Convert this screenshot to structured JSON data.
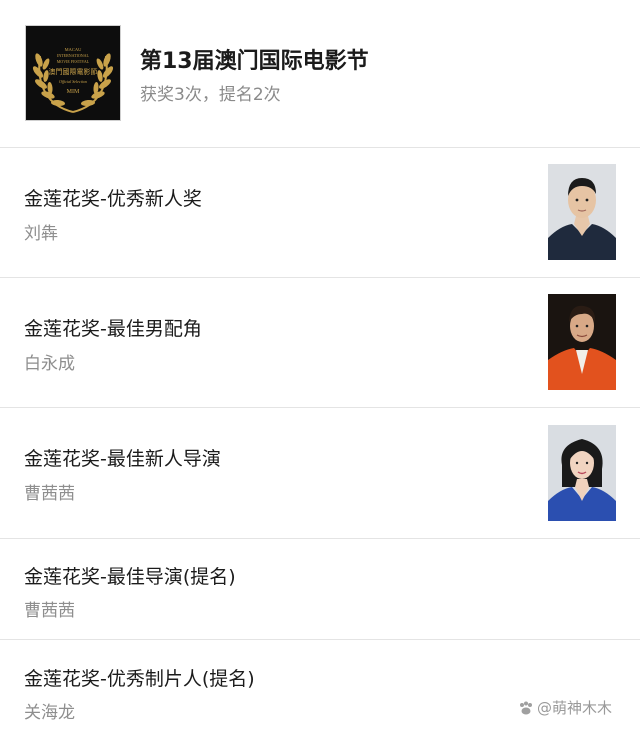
{
  "festival": {
    "title": "第13届澳门国际电影节",
    "stats": "获奖3次，提名2次",
    "logo": {
      "icon": "laurel-wreath-logo",
      "line1": "MACAU",
      "line2": "INTERNATIONAL",
      "line3": "MOVIE FESTIVAL",
      "name_cn": "澳門國際電影節",
      "selection": "Official Selection",
      "abbr": "MIM",
      "colors": {
        "background": "#0d0d0d",
        "gold": "#c9a24a"
      }
    }
  },
  "awards": [
    {
      "title": "金莲花奖-优秀新人奖",
      "person": "刘犇",
      "photo": "portrait-photo-man-dark-jacket"
    },
    {
      "title": "金莲花奖-最佳男配角",
      "person": "白永成",
      "photo": "portrait-photo-man-orange-jacket"
    },
    {
      "title": "金莲花奖-最佳新人导演",
      "person": "曹茜茜",
      "photo": "portrait-photo-woman-blue-blazer"
    },
    {
      "title": "金莲花奖-最佳导演(提名)",
      "person": "曹茜茜",
      "photo": null
    },
    {
      "title": "金莲花奖-优秀制片人(提名)",
      "person": "关海龙",
      "photo": null
    }
  ],
  "watermark": {
    "text": "@萌神木木",
    "icon": "watermark-paw-icon"
  },
  "colors": {
    "divider": "#e4e4e4",
    "secondary_text": "#8e8e8e",
    "primary_text": "#1c1c1c"
  }
}
